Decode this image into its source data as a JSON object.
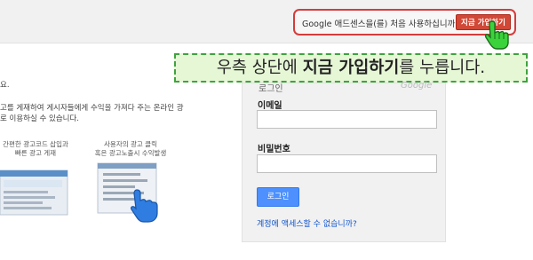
{
  "colors": {
    "signup_button": "#d14836",
    "callout_bg": "#e6f7d6",
    "callout_border": "#3fa33f",
    "login_button": "#4d90fe",
    "link": "#1155cc"
  },
  "header": {
    "signup_question": "Google 애드센스을(를) 처음 사용하십니까?",
    "signup_button": "지금 가입하기",
    "cursor_icon": "hand-pointer-icon"
  },
  "callout": {
    "prefix": "우측 상단에 ",
    "highlight": "지금 가입하기",
    "suffix": "를 누릅니다."
  },
  "intro": {
    "line1": "요.",
    "line2": "고를 게재하여 게시자들에게 수익을 가져다 주는 온라인 광",
    "line3": "로 이용하실 수 있습니다."
  },
  "features": [
    {
      "line1": "간편한 광고코드 삽입과",
      "line2": "빠른 광고 게재",
      "icon": "webpage-ad-icon"
    },
    {
      "line1": "사용자의 광고 클릭",
      "line2": "혹은 광고노출시 수익발생",
      "icon": "click-hand-icon"
    }
  ],
  "login": {
    "title": "로그인",
    "logo": "Google",
    "email_label": "이메일",
    "email_value": "",
    "password_label": "비밀번호",
    "password_value": "",
    "submit": "로그인",
    "help_link": "계정에 액세스할 수 없습니까?"
  }
}
